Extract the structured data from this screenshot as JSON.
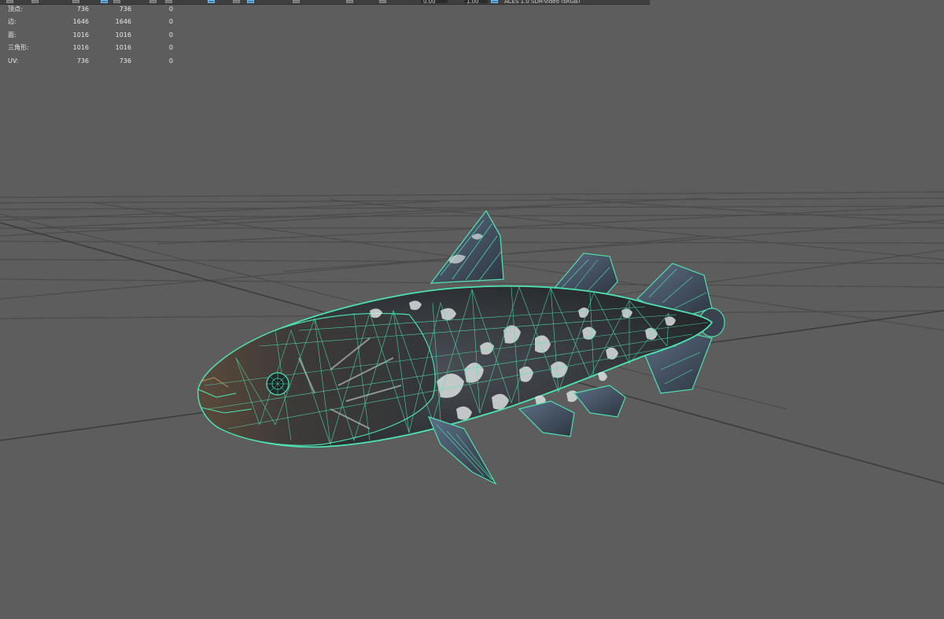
{
  "toolbar": {
    "camera_value_1": "0.00",
    "camera_value_2": "1.00",
    "color_space": "ACES 1.0 SDR-video (sRGB)"
  },
  "hud": {
    "rows": [
      {
        "label": "顶点:",
        "selected": "736",
        "total": "736",
        "extra": "0"
      },
      {
        "label": "边:",
        "selected": "1646",
        "total": "1646",
        "extra": "0"
      },
      {
        "label": "面:",
        "selected": "1016",
        "total": "1016",
        "extra": "0"
      },
      {
        "label": "三角形:",
        "selected": "1016",
        "total": "1016",
        "extra": "0"
      },
      {
        "label": "UV:",
        "selected": "736",
        "total": "736",
        "extra": "0"
      }
    ]
  },
  "viewport": {
    "background_color": "#5d5d5d",
    "grid_color": "#4a4a4a",
    "axis_color": "#3a3a3a",
    "wireframe_color": "#4fe0b0",
    "model": "coelacanth-fish-mesh"
  }
}
